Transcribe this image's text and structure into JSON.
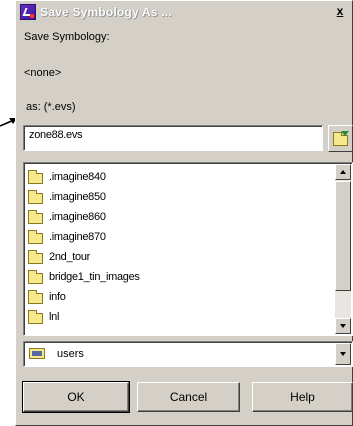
{
  "window": {
    "title": "Save Symbology As ...",
    "close_label": "x"
  },
  "labels": {
    "save_symbology": "Save Symbology:",
    "current_value": "<none>",
    "as_filter": "as: (*.evs)"
  },
  "filename_input": {
    "value": "zone88.evs"
  },
  "file_list": {
    "items": [
      {
        "label": ".imagine840",
        "icon": "folder-icon"
      },
      {
        "label": ".imagine850",
        "icon": "folder-icon"
      },
      {
        "label": ".imagine860",
        "icon": "folder-icon"
      },
      {
        "label": ".imagine870",
        "icon": "folder-icon"
      },
      {
        "label": "2nd_tour",
        "icon": "folder-icon"
      },
      {
        "label": "bridge1_tin_images",
        "icon": "folder-icon"
      },
      {
        "label": "info",
        "icon": "folder-icon"
      },
      {
        "label": "lnl",
        "icon": "folder-icon"
      }
    ]
  },
  "directory_combo": {
    "value": "users",
    "icon": "drive-folder-icon"
  },
  "buttons": {
    "ok": "OK",
    "cancel": "Cancel",
    "help": "Help"
  }
}
